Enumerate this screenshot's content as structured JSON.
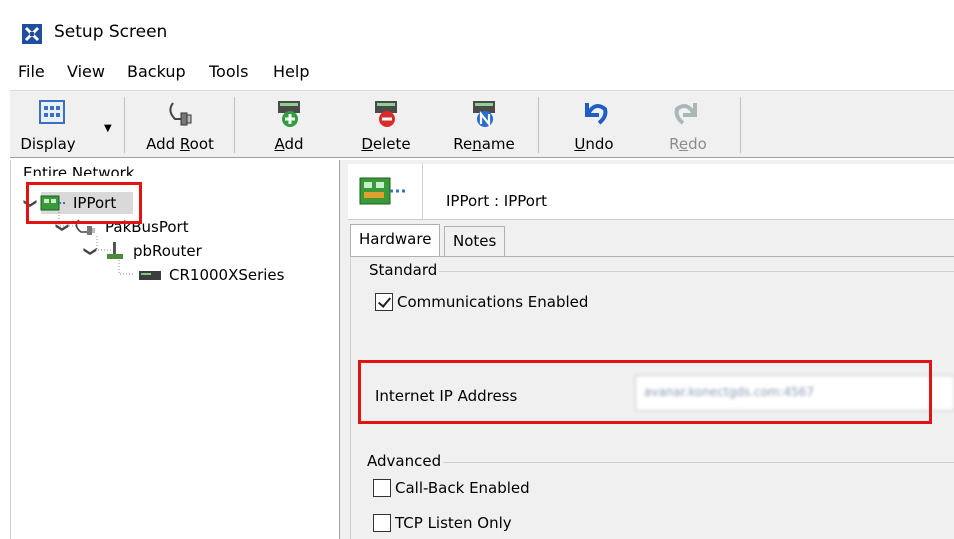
{
  "window": {
    "title": "Setup Screen"
  },
  "menu": {
    "items": [
      "File",
      "View",
      "Backup",
      "Tools",
      "Help"
    ]
  },
  "toolbar": {
    "display": {
      "label": "Display"
    },
    "add_root": {
      "label_pre": "Add ",
      "label_ul": "R",
      "label_post": "oot"
    },
    "add": {
      "label_ul": "A",
      "label_post": "dd"
    },
    "delete": {
      "label_ul": "D",
      "label_post": "elete"
    },
    "rename": {
      "label_pre": "Re",
      "label_ul": "n",
      "label_post": "ame"
    },
    "undo": {
      "label_ul": "U",
      "label_post": "ndo"
    },
    "redo": {
      "label_pre": "R",
      "label_ul": "e",
      "label_post": "do"
    }
  },
  "tree": {
    "header": "Entire Network",
    "nodes": [
      {
        "label": "IPPort"
      },
      {
        "label": "PakBusPort"
      },
      {
        "label": "pbRouter"
      },
      {
        "label": "CR1000XSeries"
      }
    ]
  },
  "device": {
    "title": "IPPort : IPPort"
  },
  "tabs": [
    "Hardware",
    "Notes"
  ],
  "hardware": {
    "standard_label": "Standard",
    "comm_enabled_label": "Communications Enabled",
    "comm_enabled": true,
    "ip_label": "Internet IP Address",
    "ip_value": "avanar.konectgds.com:4567",
    "advanced_label": "Advanced",
    "callback_label": "Call-Back Enabled",
    "callback": false,
    "tcp_listen_label": "TCP Listen Only",
    "tcp_listen": false
  },
  "colors": {
    "highlight": "#e11414",
    "accent": "#1a5fb4"
  }
}
